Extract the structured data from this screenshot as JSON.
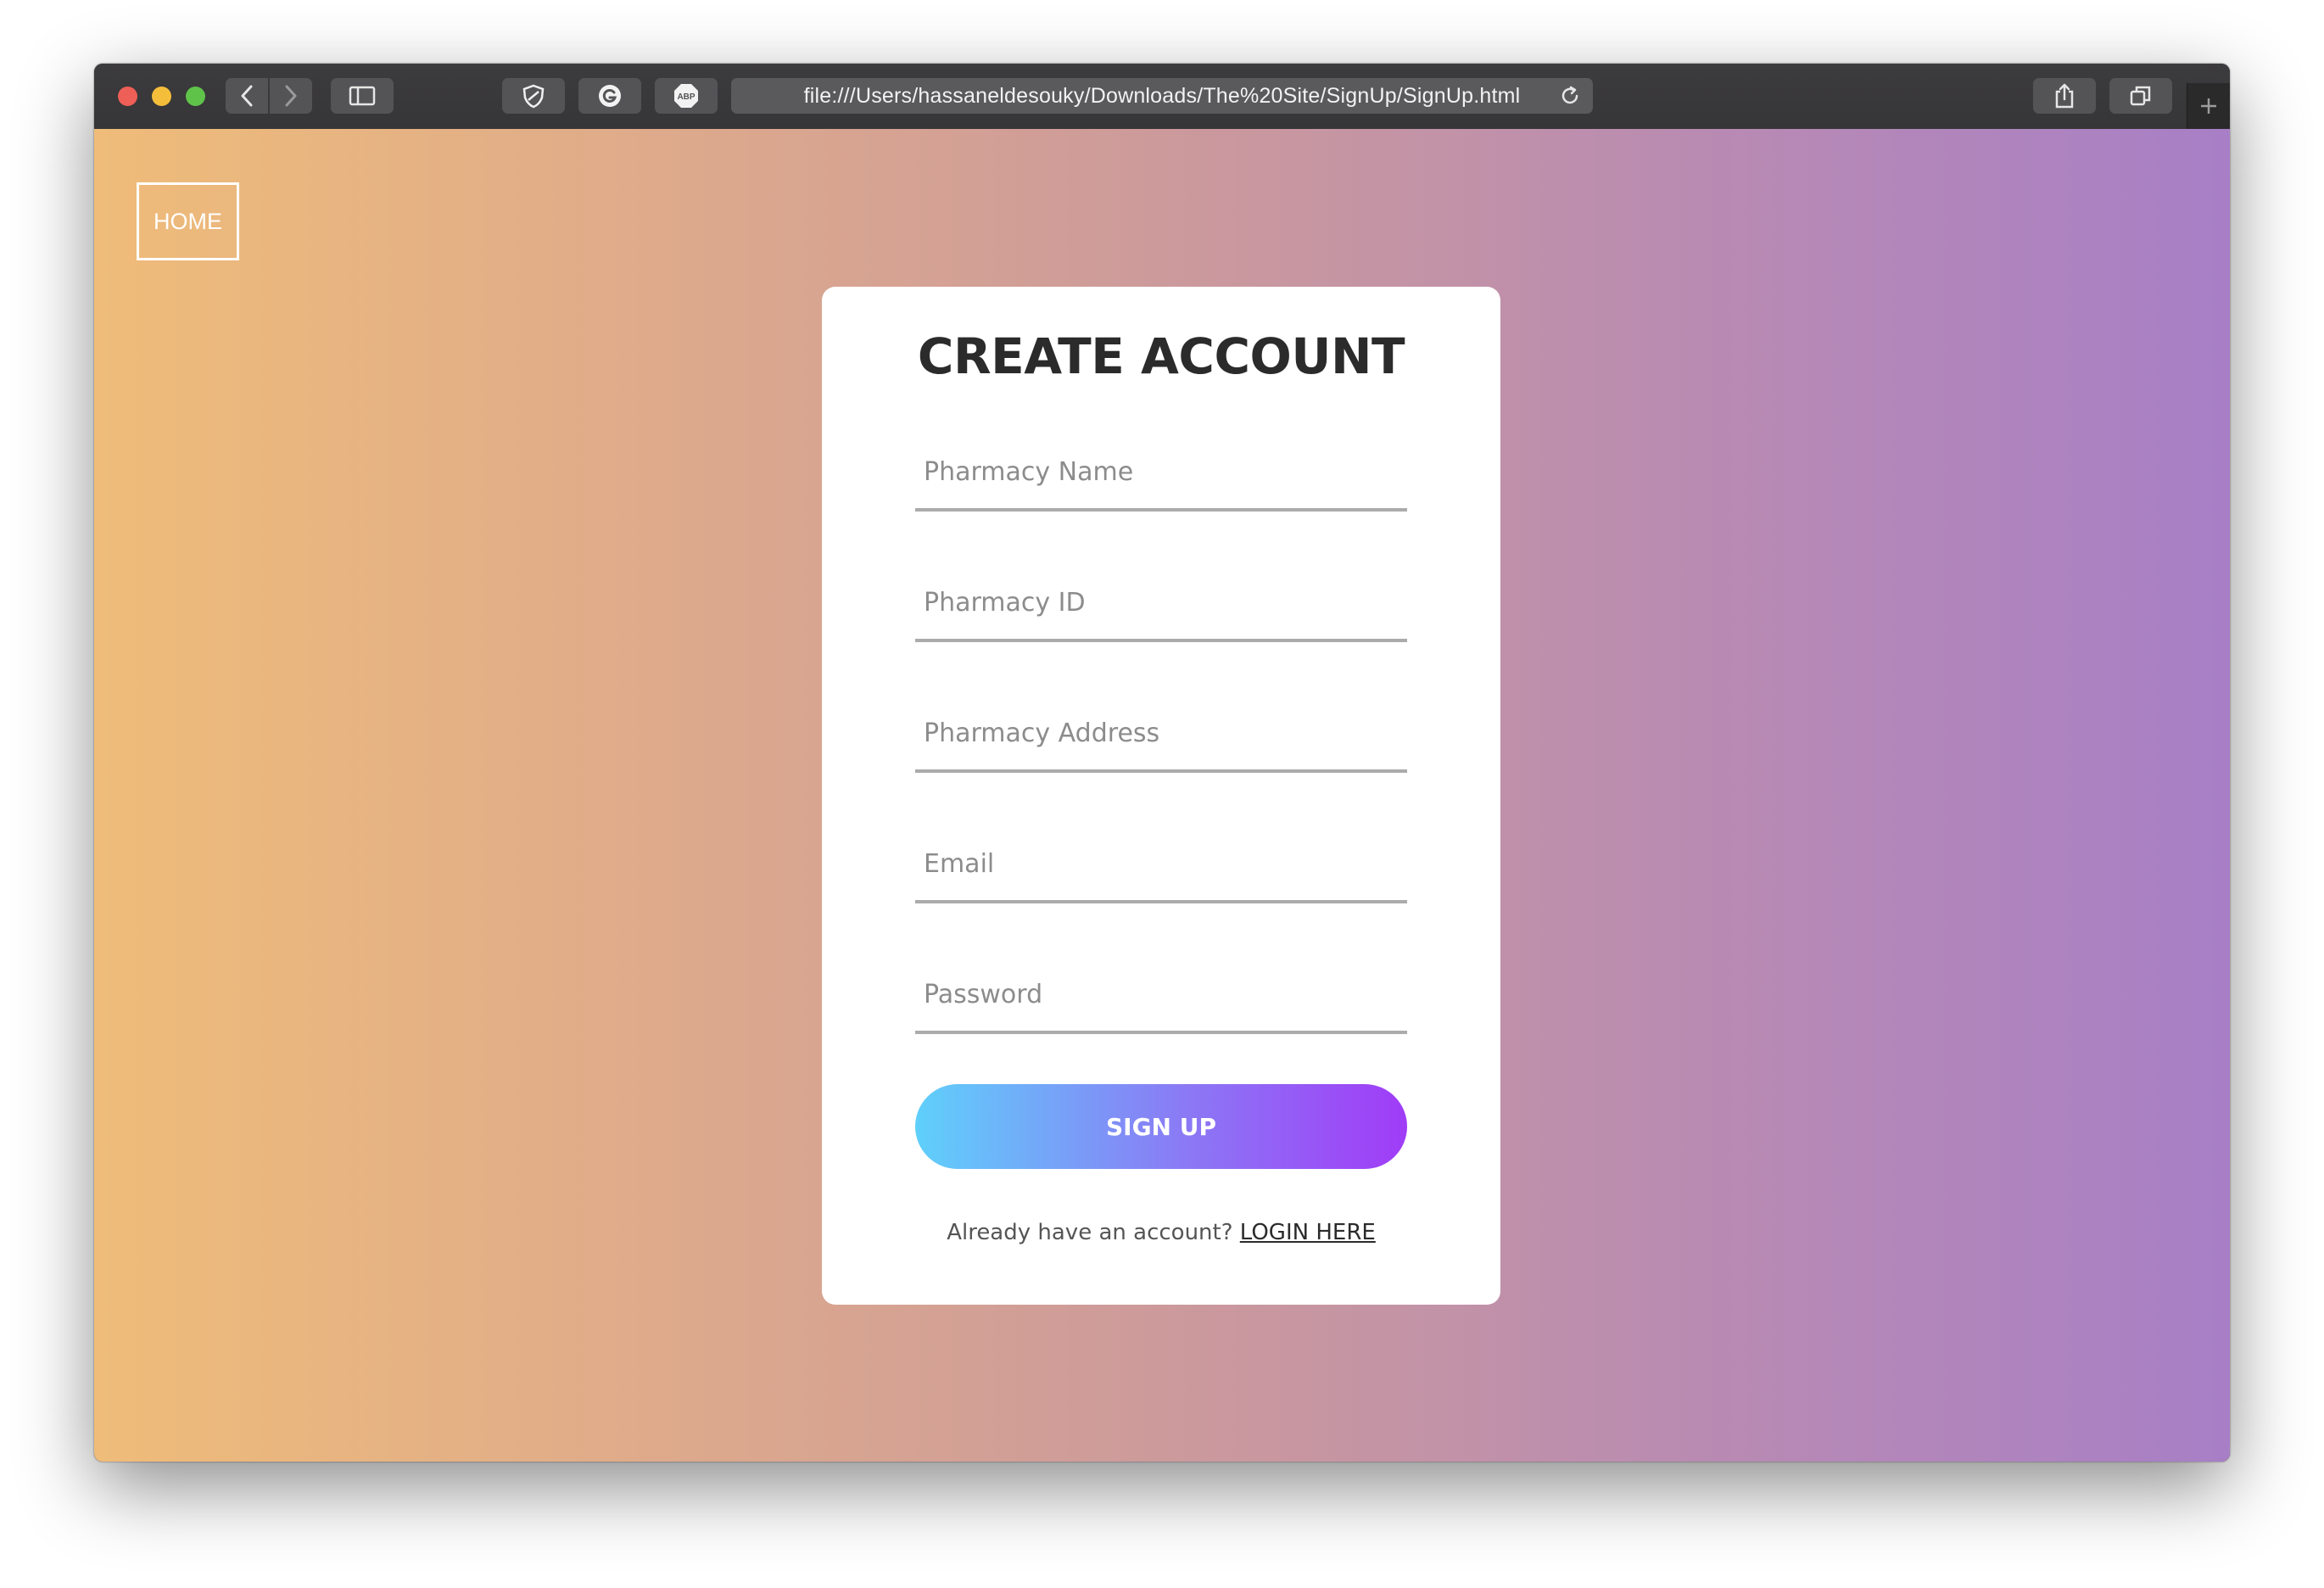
{
  "browser": {
    "url": "file:///Users/hassaneldesouky/Downloads/The%20Site/SignUp/SignUp.html",
    "toolbar_icons": [
      "back-icon",
      "forward-icon",
      "sidebar-icon",
      "shield-icon",
      "grammarly-icon",
      "adblock-icon",
      "reload-icon",
      "share-icon",
      "tabs-icon",
      "plus-icon"
    ],
    "adblock_label": "ABP"
  },
  "nav": {
    "home_label": "HOME"
  },
  "form": {
    "title": "CREATE ACCOUNT",
    "fields": [
      {
        "placeholder": "Pharmacy Name",
        "value": ""
      },
      {
        "placeholder": "Pharmacy ID",
        "value": ""
      },
      {
        "placeholder": "Pharmacy Address",
        "value": ""
      },
      {
        "placeholder": "Email",
        "value": ""
      },
      {
        "placeholder": "Password",
        "value": ""
      }
    ],
    "submit_label": "SIGN UP",
    "login_prompt": "Already have an account?",
    "login_link": "LOGIN HERE"
  },
  "colors": {
    "gradient_start": "#efbc79",
    "gradient_end": "#a87fc6",
    "button_start": "#5fd0fb",
    "button_end": "#a03cf7",
    "title": "#2b2b2b"
  }
}
